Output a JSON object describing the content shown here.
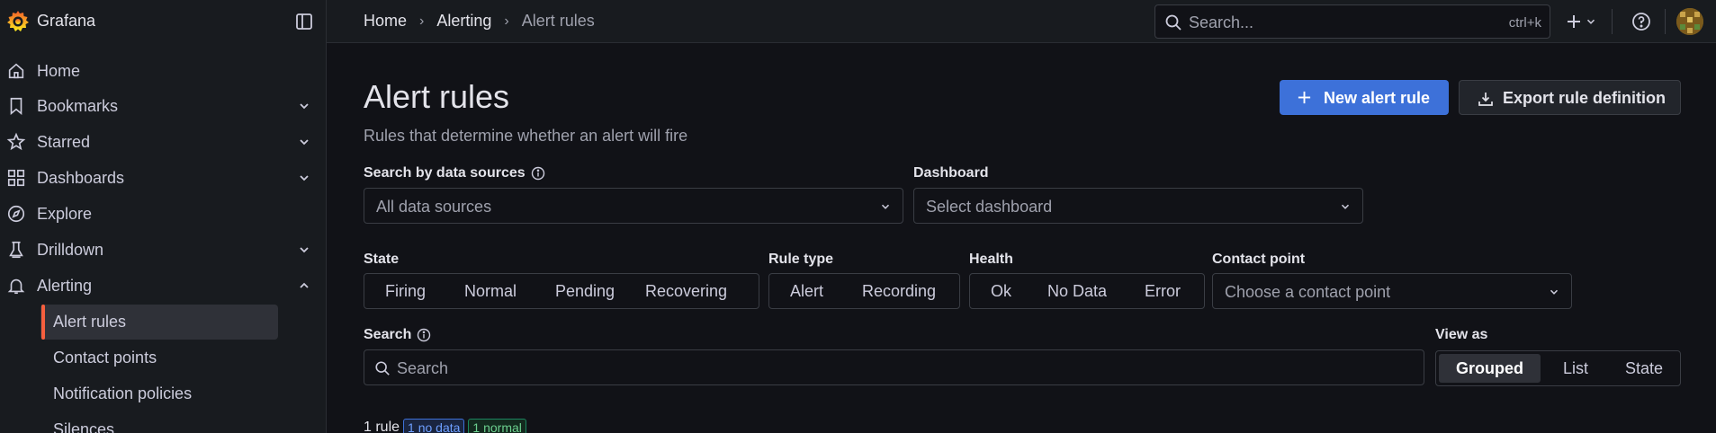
{
  "app": {
    "name": "Grafana"
  },
  "sidebar": {
    "items": [
      {
        "label": "Home",
        "icon": "home-icon",
        "expandable": false
      },
      {
        "label": "Bookmarks",
        "icon": "bookmark-icon",
        "expandable": true
      },
      {
        "label": "Starred",
        "icon": "star-icon",
        "expandable": true
      },
      {
        "label": "Dashboards",
        "icon": "apps-icon",
        "expandable": true
      },
      {
        "label": "Explore",
        "icon": "compass-icon",
        "expandable": false
      },
      {
        "label": "Drilldown",
        "icon": "drilldown-icon",
        "expandable": true
      },
      {
        "label": "Alerting",
        "icon": "bell-icon",
        "expandable": true,
        "expanded": true
      }
    ],
    "alerting_children": [
      {
        "label": "Alert rules",
        "active": true
      },
      {
        "label": "Contact points",
        "active": false
      },
      {
        "label": "Notification policies",
        "active": false
      },
      {
        "label": "Silences",
        "active": false
      }
    ]
  },
  "topbar": {
    "breadcrumbs": [
      "Home",
      "Alerting",
      "Alert rules"
    ],
    "search_placeholder": "Search...",
    "search_shortcut": "ctrl+k"
  },
  "page": {
    "title": "Alert rules",
    "subtitle": "Rules that determine whether an alert will fire",
    "new_button": "New alert rule",
    "export_button": "Export rule definition"
  },
  "filters": {
    "datasource_label": "Search by data sources",
    "datasource_value": "All data sources",
    "dashboard_label": "Dashboard",
    "dashboard_value": "Select dashboard",
    "state_label": "State",
    "state_options": [
      "Firing",
      "Normal",
      "Pending",
      "Recovering"
    ],
    "ruletype_label": "Rule type",
    "ruletype_options": [
      "Alert",
      "Recording"
    ],
    "health_label": "Health",
    "health_options": [
      "Ok",
      "No Data",
      "Error"
    ],
    "contact_label": "Contact point",
    "contact_value": "Choose a contact point",
    "search_label": "Search",
    "search_placeholder": "Search",
    "view_label": "View as",
    "view_options": [
      "Grouped",
      "List",
      "State"
    ],
    "view_selected": "Grouped"
  },
  "summary": {
    "count": "1 rule",
    "badges": [
      "1 no data",
      "1 normal"
    ]
  },
  "colors": {
    "accent": "#3d71d9",
    "active_marker": "#f55f3e",
    "background": "#111217",
    "panel": "#181b1f"
  }
}
